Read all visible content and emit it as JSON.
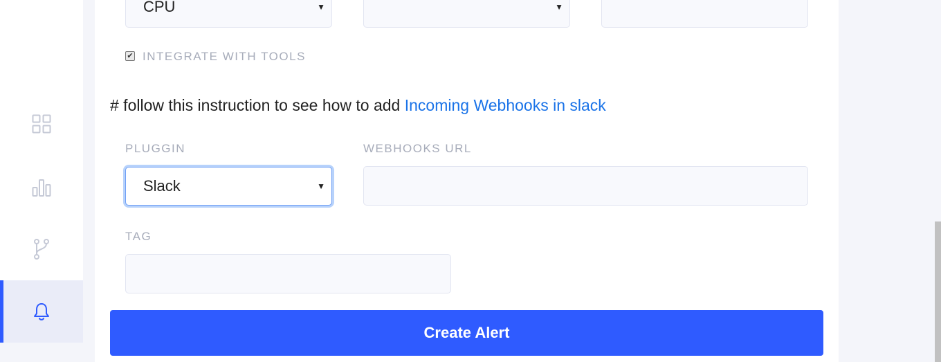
{
  "form": {
    "metric_select": {
      "value": "CPU"
    },
    "operator_select": {
      "value": ""
    },
    "threshold_input": {
      "value": ""
    },
    "integrate_checkbox": {
      "label": "INTEGRATE WITH TOOLS",
      "checked": true,
      "check_glyph": "✔"
    },
    "instruction": {
      "text": "# follow this instruction to see how to add ",
      "link": "Incoming Webhooks in slack"
    },
    "plugin": {
      "label": "PLUGGIN",
      "value": "Slack"
    },
    "webhook": {
      "label": "WEBHOOKS URL",
      "value": ""
    },
    "tag": {
      "label": "TAG",
      "value": ""
    },
    "caret": "▼",
    "submit_label": "Create Alert"
  },
  "sidebar": {
    "items": [
      {
        "name": "dashboard",
        "icon": "grid-icon",
        "active": false
      },
      {
        "name": "stats",
        "icon": "bar-chart-icon",
        "active": false
      },
      {
        "name": "branch",
        "icon": "branch-icon",
        "active": false
      },
      {
        "name": "alerts",
        "icon": "bell-icon",
        "active": true
      }
    ]
  },
  "colors": {
    "accent": "#2f5bff",
    "link": "#1a73e8",
    "label": "#a7acba",
    "icon": "#c5c9d6"
  }
}
